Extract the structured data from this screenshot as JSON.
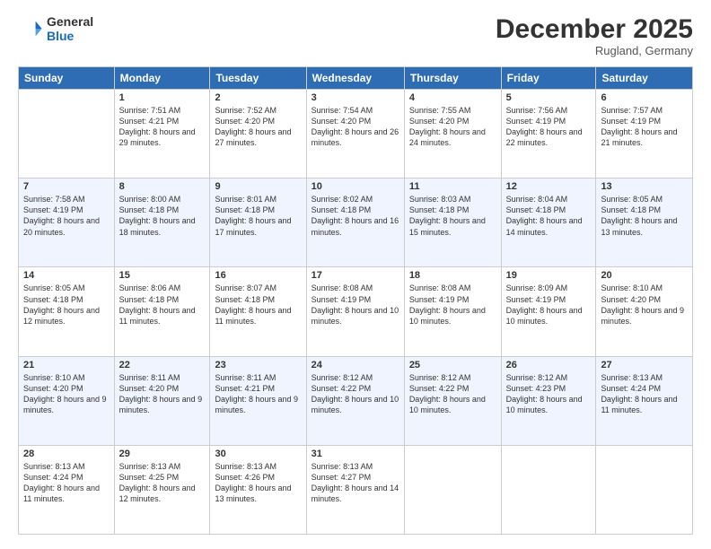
{
  "logo": {
    "line1": "General",
    "line2": "Blue"
  },
  "header": {
    "title": "December 2025",
    "subtitle": "Rugland, Germany"
  },
  "weekdays": [
    "Sunday",
    "Monday",
    "Tuesday",
    "Wednesday",
    "Thursday",
    "Friday",
    "Saturday"
  ],
  "weeks": [
    [
      {
        "day": "",
        "sunrise": "",
        "sunset": "",
        "daylight": ""
      },
      {
        "day": "1",
        "sunrise": "Sunrise: 7:51 AM",
        "sunset": "Sunset: 4:21 PM",
        "daylight": "Daylight: 8 hours and 29 minutes."
      },
      {
        "day": "2",
        "sunrise": "Sunrise: 7:52 AM",
        "sunset": "Sunset: 4:20 PM",
        "daylight": "Daylight: 8 hours and 27 minutes."
      },
      {
        "day": "3",
        "sunrise": "Sunrise: 7:54 AM",
        "sunset": "Sunset: 4:20 PM",
        "daylight": "Daylight: 8 hours and 26 minutes."
      },
      {
        "day": "4",
        "sunrise": "Sunrise: 7:55 AM",
        "sunset": "Sunset: 4:20 PM",
        "daylight": "Daylight: 8 hours and 24 minutes."
      },
      {
        "day": "5",
        "sunrise": "Sunrise: 7:56 AM",
        "sunset": "Sunset: 4:19 PM",
        "daylight": "Daylight: 8 hours and 22 minutes."
      },
      {
        "day": "6",
        "sunrise": "Sunrise: 7:57 AM",
        "sunset": "Sunset: 4:19 PM",
        "daylight": "Daylight: 8 hours and 21 minutes."
      }
    ],
    [
      {
        "day": "7",
        "sunrise": "Sunrise: 7:58 AM",
        "sunset": "Sunset: 4:19 PM",
        "daylight": "Daylight: 8 hours and 20 minutes."
      },
      {
        "day": "8",
        "sunrise": "Sunrise: 8:00 AM",
        "sunset": "Sunset: 4:18 PM",
        "daylight": "Daylight: 8 hours and 18 minutes."
      },
      {
        "day": "9",
        "sunrise": "Sunrise: 8:01 AM",
        "sunset": "Sunset: 4:18 PM",
        "daylight": "Daylight: 8 hours and 17 minutes."
      },
      {
        "day": "10",
        "sunrise": "Sunrise: 8:02 AM",
        "sunset": "Sunset: 4:18 PM",
        "daylight": "Daylight: 8 hours and 16 minutes."
      },
      {
        "day": "11",
        "sunrise": "Sunrise: 8:03 AM",
        "sunset": "Sunset: 4:18 PM",
        "daylight": "Daylight: 8 hours and 15 minutes."
      },
      {
        "day": "12",
        "sunrise": "Sunrise: 8:04 AM",
        "sunset": "Sunset: 4:18 PM",
        "daylight": "Daylight: 8 hours and 14 minutes."
      },
      {
        "day": "13",
        "sunrise": "Sunrise: 8:05 AM",
        "sunset": "Sunset: 4:18 PM",
        "daylight": "Daylight: 8 hours and 13 minutes."
      }
    ],
    [
      {
        "day": "14",
        "sunrise": "Sunrise: 8:05 AM",
        "sunset": "Sunset: 4:18 PM",
        "daylight": "Daylight: 8 hours and 12 minutes."
      },
      {
        "day": "15",
        "sunrise": "Sunrise: 8:06 AM",
        "sunset": "Sunset: 4:18 PM",
        "daylight": "Daylight: 8 hours and 11 minutes."
      },
      {
        "day": "16",
        "sunrise": "Sunrise: 8:07 AM",
        "sunset": "Sunset: 4:18 PM",
        "daylight": "Daylight: 8 hours and 11 minutes."
      },
      {
        "day": "17",
        "sunrise": "Sunrise: 8:08 AM",
        "sunset": "Sunset: 4:19 PM",
        "daylight": "Daylight: 8 hours and 10 minutes."
      },
      {
        "day": "18",
        "sunrise": "Sunrise: 8:08 AM",
        "sunset": "Sunset: 4:19 PM",
        "daylight": "Daylight: 8 hours and 10 minutes."
      },
      {
        "day": "19",
        "sunrise": "Sunrise: 8:09 AM",
        "sunset": "Sunset: 4:19 PM",
        "daylight": "Daylight: 8 hours and 10 minutes."
      },
      {
        "day": "20",
        "sunrise": "Sunrise: 8:10 AM",
        "sunset": "Sunset: 4:20 PM",
        "daylight": "Daylight: 8 hours and 9 minutes."
      }
    ],
    [
      {
        "day": "21",
        "sunrise": "Sunrise: 8:10 AM",
        "sunset": "Sunset: 4:20 PM",
        "daylight": "Daylight: 8 hours and 9 minutes."
      },
      {
        "day": "22",
        "sunrise": "Sunrise: 8:11 AM",
        "sunset": "Sunset: 4:20 PM",
        "daylight": "Daylight: 8 hours and 9 minutes."
      },
      {
        "day": "23",
        "sunrise": "Sunrise: 8:11 AM",
        "sunset": "Sunset: 4:21 PM",
        "daylight": "Daylight: 8 hours and 9 minutes."
      },
      {
        "day": "24",
        "sunrise": "Sunrise: 8:12 AM",
        "sunset": "Sunset: 4:22 PM",
        "daylight": "Daylight: 8 hours and 10 minutes."
      },
      {
        "day": "25",
        "sunrise": "Sunrise: 8:12 AM",
        "sunset": "Sunset: 4:22 PM",
        "daylight": "Daylight: 8 hours and 10 minutes."
      },
      {
        "day": "26",
        "sunrise": "Sunrise: 8:12 AM",
        "sunset": "Sunset: 4:23 PM",
        "daylight": "Daylight: 8 hours and 10 minutes."
      },
      {
        "day": "27",
        "sunrise": "Sunrise: 8:13 AM",
        "sunset": "Sunset: 4:24 PM",
        "daylight": "Daylight: 8 hours and 11 minutes."
      }
    ],
    [
      {
        "day": "28",
        "sunrise": "Sunrise: 8:13 AM",
        "sunset": "Sunset: 4:24 PM",
        "daylight": "Daylight: 8 hours and 11 minutes."
      },
      {
        "day": "29",
        "sunrise": "Sunrise: 8:13 AM",
        "sunset": "Sunset: 4:25 PM",
        "daylight": "Daylight: 8 hours and 12 minutes."
      },
      {
        "day": "30",
        "sunrise": "Sunrise: 8:13 AM",
        "sunset": "Sunset: 4:26 PM",
        "daylight": "Daylight: 8 hours and 13 minutes."
      },
      {
        "day": "31",
        "sunrise": "Sunrise: 8:13 AM",
        "sunset": "Sunset: 4:27 PM",
        "daylight": "Daylight: 8 hours and 14 minutes."
      },
      {
        "day": "",
        "sunrise": "",
        "sunset": "",
        "daylight": ""
      },
      {
        "day": "",
        "sunrise": "",
        "sunset": "",
        "daylight": ""
      },
      {
        "day": "",
        "sunrise": "",
        "sunset": "",
        "daylight": ""
      }
    ]
  ]
}
